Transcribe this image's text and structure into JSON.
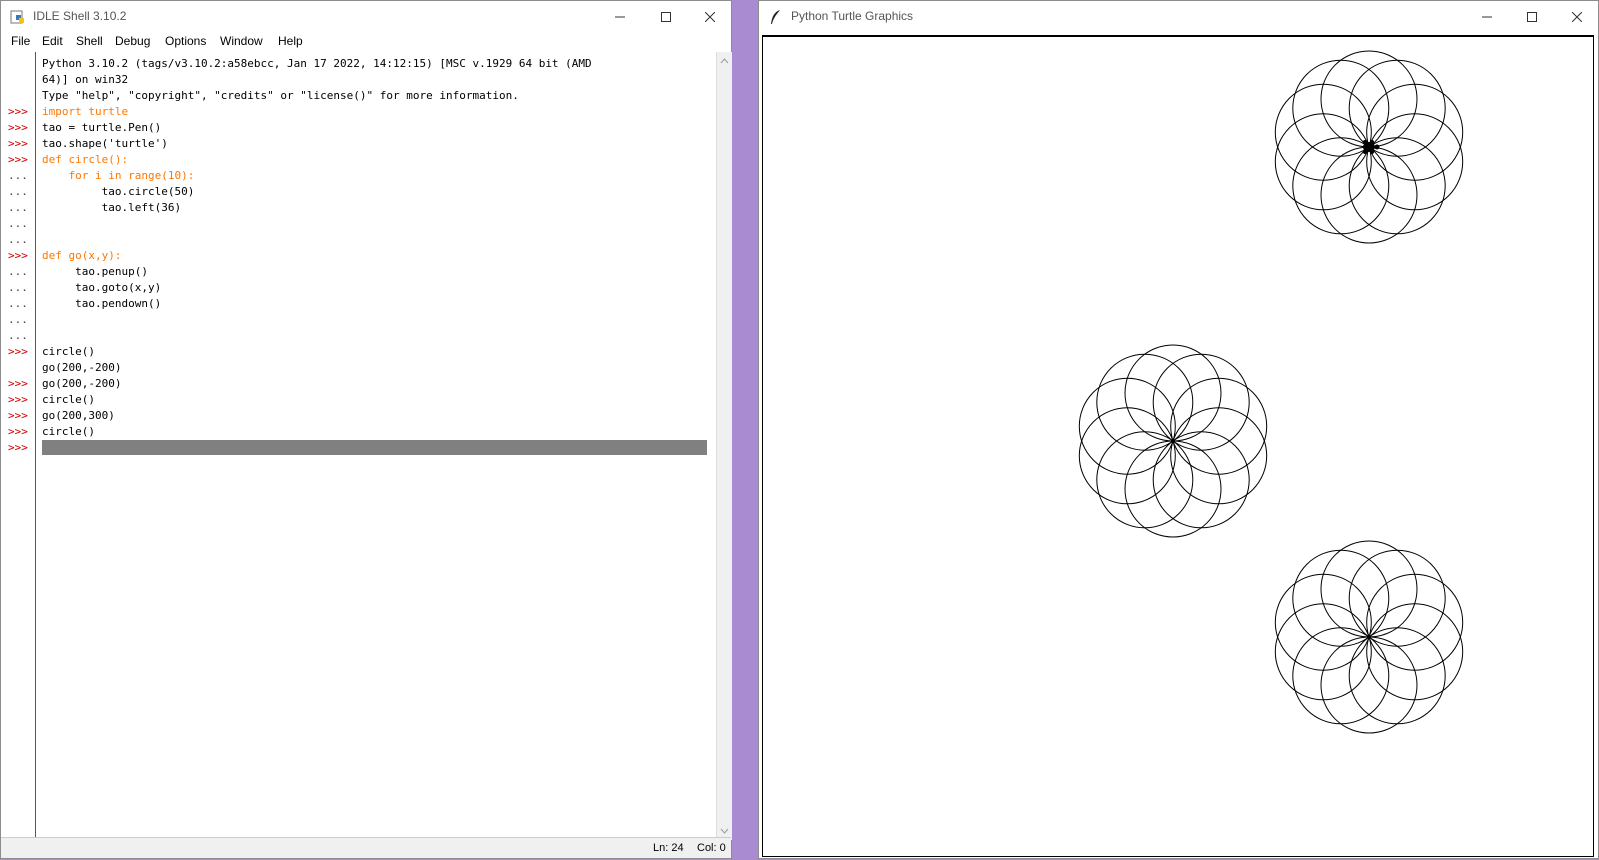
{
  "idle": {
    "title": "IDLE Shell 3.10.2",
    "menu": [
      "File",
      "Edit",
      "Shell",
      "Debug",
      "Options",
      "Window",
      "Help"
    ],
    "banner": [
      "Python 3.10.2 (tags/v3.10.2:a58ebcc, Jan 17 2022, 14:12:15) [MSC v.1929 64 bit (AMD",
      "64)] on win32",
      "Type \"help\", \"copyright\", \"credits\" or \"license()\" for more information."
    ],
    "prompt_primary": ">>>",
    "prompt_cont": "...",
    "code": {
      "l4": "import turtle",
      "l5": "tao = turtle.Pen()",
      "l6": "tao.shape('turtle')",
      "l7": "def circle():",
      "l8": "    for i in range(10):",
      "l9": "         tao.circle(50)",
      "l10": "         tao.left(36)",
      "l13": "def go(x,y):",
      "l14": "     tao.penup()",
      "l15": "     tao.goto(x,y)",
      "l16": "     tao.pendown()",
      "l19": "circle()",
      "l20": "go(200,-200)",
      "l21": "go(200,-200)",
      "l22": "circle()",
      "l23": "go(200,300)",
      "l24": "circle()"
    },
    "status": {
      "line": "Ln: 24",
      "col": "Col: 0"
    }
  },
  "turtle_window": {
    "title": "Python Turtle Graphics",
    "rosettes": [
      {
        "cx_turtle": 200,
        "cy_turtle": 300,
        "with_turtle": true
      },
      {
        "cx_turtle": 0,
        "cy_turtle": 0,
        "with_turtle": false
      },
      {
        "cx_turtle": 200,
        "cy_turtle": -200,
        "with_turtle": false
      }
    ],
    "circle_radius": 50,
    "circle_count": 10,
    "turn_degrees": 36
  }
}
